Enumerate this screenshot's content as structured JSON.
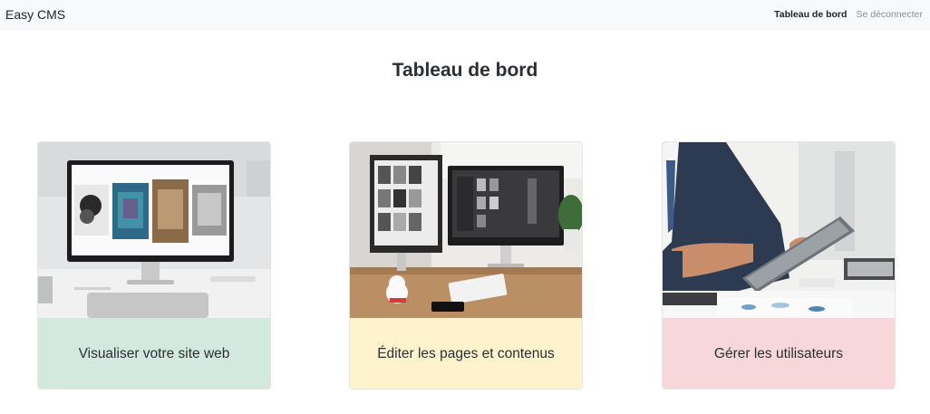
{
  "navbar": {
    "brand": "Easy CMS",
    "links": [
      {
        "label": "Tableau de bord",
        "active": true
      },
      {
        "label": "Se déconnecter",
        "active": false
      }
    ]
  },
  "page": {
    "title": "Tableau de bord"
  },
  "cards": [
    {
      "label": "Visualiser votre site web",
      "color": "#d3e8df",
      "image": "monitor-website-photo"
    },
    {
      "label": "Éditer les pages et contenus",
      "color": "#fff3cd",
      "image": "desk-monitors-photo"
    },
    {
      "label": "Gérer les utilisateurs",
      "color": "#f8d7da",
      "image": "businessman-tablet-photo"
    }
  ]
}
